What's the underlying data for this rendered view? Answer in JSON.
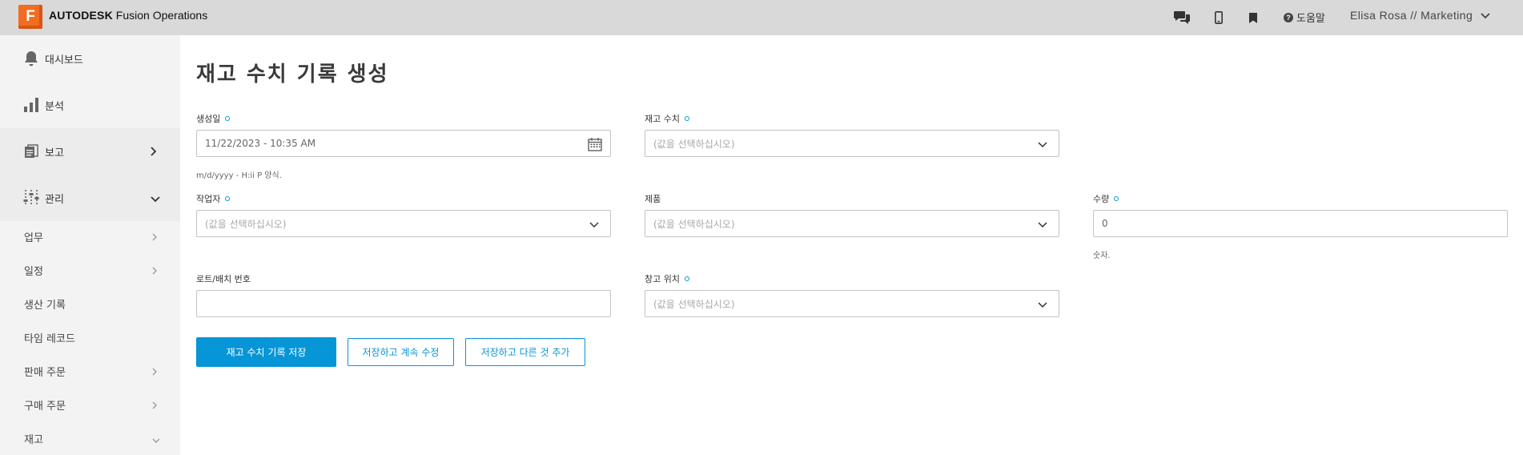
{
  "header": {
    "logo_letter": "F",
    "brand_bold": "AUTODESK",
    "brand_rest": " Fusion Operations",
    "help_label": "도움말",
    "user_label": "Elisa Rosa // Marketing"
  },
  "sidebar": {
    "main_items": [
      {
        "label": "대시보드",
        "icon": "bell-icon"
      },
      {
        "label": "분석",
        "icon": "bar-chart-icon"
      },
      {
        "label": "보고",
        "icon": "report-icon"
      },
      {
        "label": "관리",
        "icon": "sliders-icon"
      }
    ],
    "sub_items": [
      {
        "label": "업무"
      },
      {
        "label": "일정"
      },
      {
        "label": "생산 기록"
      },
      {
        "label": "타임 레코드"
      },
      {
        "label": "판매 주문"
      },
      {
        "label": "구매 주문"
      },
      {
        "label": "재고"
      }
    ]
  },
  "page": {
    "title": "재고 수치 기록 생성"
  },
  "form": {
    "created_date": {
      "label": "생성일",
      "value": "11/22/2023 - 10:35 AM",
      "help": "m/d/yyyy - H:ii P 양식."
    },
    "stock_level": {
      "label": "재고 수치",
      "placeholder": "(값을 선택하십시오)"
    },
    "worker": {
      "label": "작업자",
      "placeholder": "(값을 선택하십시오)"
    },
    "product": {
      "label": "제품",
      "placeholder": "(값을 선택하십시오)"
    },
    "quantity": {
      "label": "수량",
      "value": "0",
      "help": "숫자."
    },
    "lot_number": {
      "label": "로트/배치 번호",
      "value": ""
    },
    "location": {
      "label": "창고 위치",
      "placeholder": "(값을 선택하십시오)"
    }
  },
  "buttons": {
    "save": "재고 수치 기록 저장",
    "save_continue": "저장하고 계속 수정",
    "save_add": "저장하고 다른 것 추가"
  },
  "colors": {
    "accent": "#0696d7",
    "brand_orange": "#f26c22",
    "topbar_bg": "#d9d9d9",
    "sidebar_bg": "#f3f3f3"
  }
}
